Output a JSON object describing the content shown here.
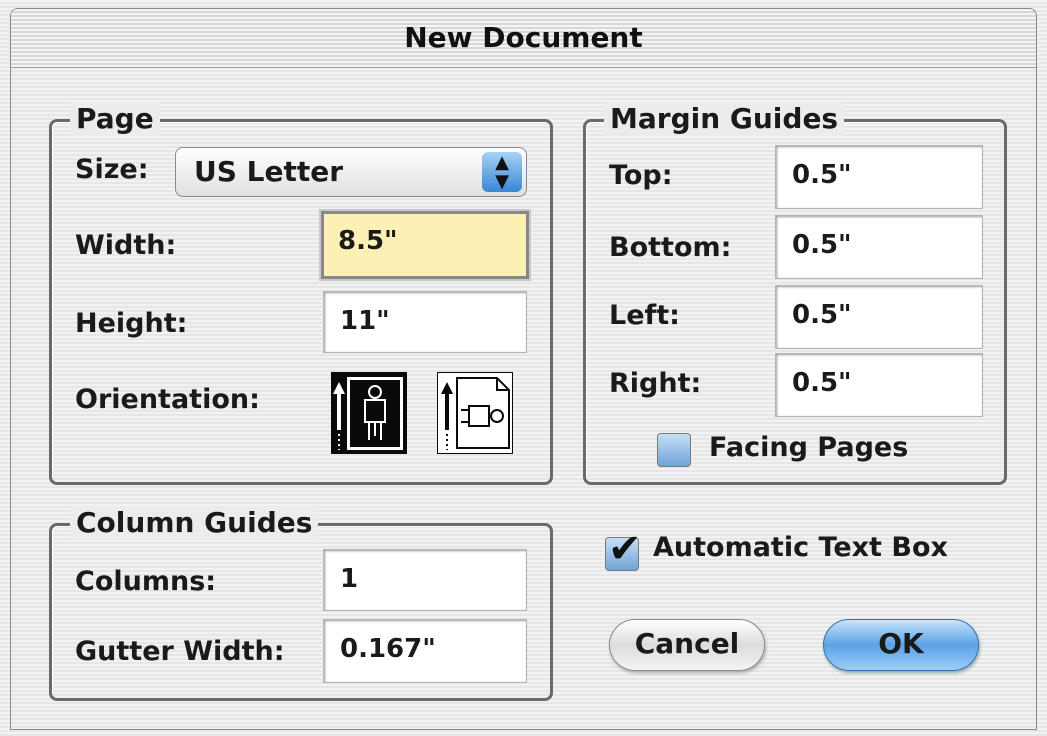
{
  "window": {
    "title": "New Document"
  },
  "page_group": {
    "legend": "Page",
    "size_label": "Size:",
    "size_value": "US Letter",
    "width_label": "Width:",
    "width_value": "8.5\"",
    "height_label": "Height:",
    "height_value": "11\"",
    "orientation_label": "Orientation:",
    "orientation_options": [
      "portrait",
      "landscape"
    ],
    "orientation_selected": "portrait"
  },
  "margin_group": {
    "legend": "Margin Guides",
    "top_label": "Top:",
    "top_value": "0.5\"",
    "bottom_label": "Bottom:",
    "bottom_value": "0.5\"",
    "left_label": "Left:",
    "left_value": "0.5\"",
    "right_label": "Right:",
    "right_value": "0.5\"",
    "facing_pages_label": "Facing Pages",
    "facing_pages_checked": false
  },
  "column_group": {
    "legend": "Column Guides",
    "columns_label": "Columns:",
    "columns_value": "1",
    "gutter_label": "Gutter Width:",
    "gutter_value": "0.167\""
  },
  "auto_text_box": {
    "label": "Automatic Text Box",
    "checked": true
  },
  "buttons": {
    "cancel": "Cancel",
    "ok": "OK"
  },
  "colors": {
    "focus_field": "#fdf0b4",
    "accent_blue": "#5aa2e6"
  }
}
